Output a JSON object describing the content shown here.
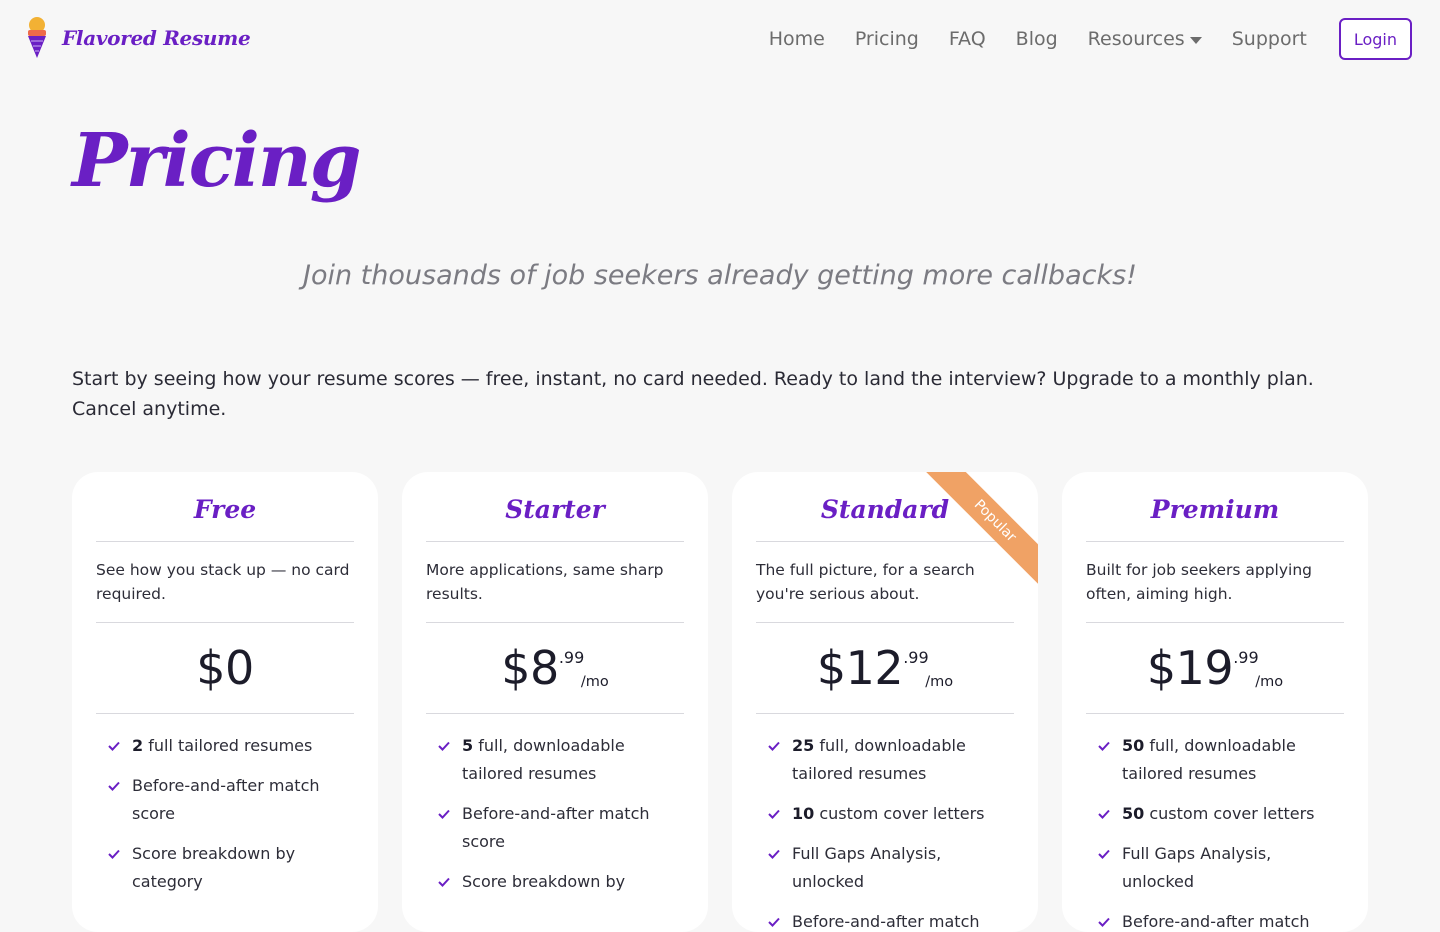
{
  "brand": {
    "name": "Flavored Resume"
  },
  "nav": {
    "links": [
      "Home",
      "Pricing",
      "FAQ",
      "Blog",
      "Resources",
      "Support"
    ],
    "login_label": "Login"
  },
  "hero": {
    "title": "Pricing",
    "tagline": "Join thousands of job seekers already getting more callbacks!",
    "intro": "Start by seeing how your resume scores — free, instant, no card needed. Ready to land the interview? Upgrade to a monthly plan. Cancel anytime."
  },
  "colors": {
    "accent": "#6a1fc4",
    "ribbon": "#f0a265",
    "background": "#f7f7f7"
  },
  "plans": [
    {
      "name": "Free",
      "description": "See how you stack up — no card required.",
      "price_main": "$0",
      "price_cents": "",
      "price_period": "",
      "features": [
        {
          "bold": "2",
          "text": " full tailored resumes"
        },
        {
          "bold": "",
          "text": "Before-and-after match score"
        },
        {
          "bold": "",
          "text": "Score breakdown by category"
        }
      ]
    },
    {
      "name": "Starter",
      "description": "More applications, same sharp results.",
      "price_main": "$8",
      "price_cents": ".99",
      "price_period": "/mo",
      "features": [
        {
          "bold": "5",
          "text": " full, downloadable tailored resumes"
        },
        {
          "bold": "",
          "text": "Before-and-after match score"
        },
        {
          "bold": "",
          "text": "Score breakdown by"
        }
      ]
    },
    {
      "name": "Standard",
      "description": "The full picture, for a search you're serious about.",
      "price_main": "$12",
      "price_cents": ".99",
      "price_period": "/mo",
      "ribbon": "Popular",
      "features": [
        {
          "bold": "25",
          "text": " full, downloadable tailored resumes"
        },
        {
          "bold": "10",
          "text": " custom cover letters"
        },
        {
          "bold": "",
          "text": "Full Gaps Analysis, unlocked"
        },
        {
          "bold": "",
          "text": "Before-and-after match"
        }
      ]
    },
    {
      "name": "Premium",
      "description": "Built for job seekers applying often, aiming high.",
      "price_main": "$19",
      "price_cents": ".99",
      "price_period": "/mo",
      "features": [
        {
          "bold": "50",
          "text": " full, downloadable tailored resumes"
        },
        {
          "bold": "50",
          "text": " custom cover letters"
        },
        {
          "bold": "",
          "text": "Full Gaps Analysis, unlocked"
        },
        {
          "bold": "",
          "text": "Before-and-after match"
        }
      ]
    }
  ]
}
